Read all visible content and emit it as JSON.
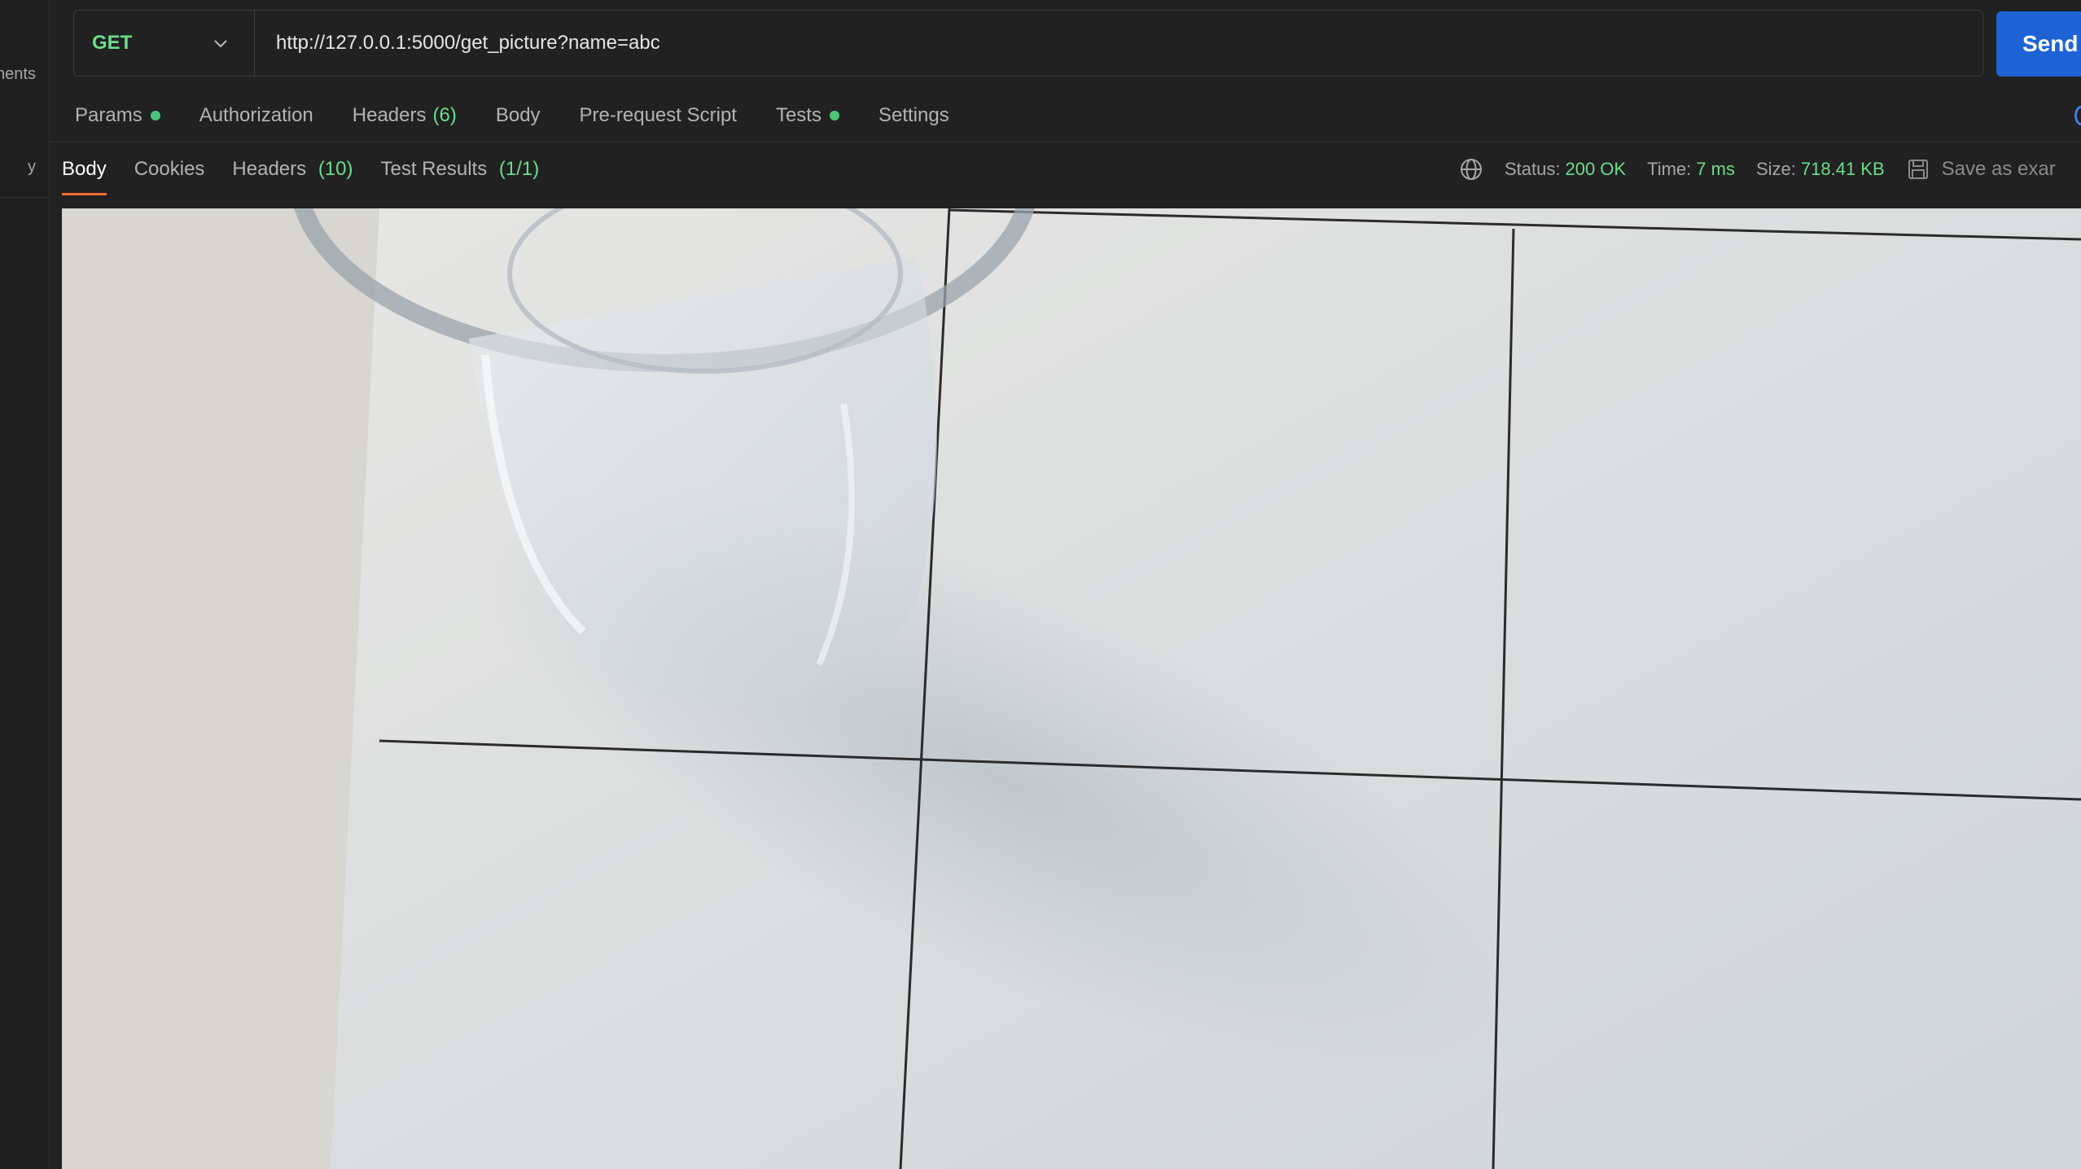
{
  "sidebar": {
    "items": [
      {
        "label": "nents"
      },
      {
        "label": "y"
      }
    ]
  },
  "request": {
    "method": "GET",
    "url": "http://127.0.0.1:5000/get_picture?name=abc",
    "send_label": "Send"
  },
  "request_tabs": {
    "params": "Params",
    "authorization": "Authorization",
    "headers": "Headers",
    "headers_count": "(6)",
    "body": "Body",
    "prerequest": "Pre-request Script",
    "tests": "Tests",
    "settings": "Settings"
  },
  "response_tabs": {
    "body": "Body",
    "cookies": "Cookies",
    "headers": "Headers",
    "headers_count": "(10)",
    "test_results": "Test Results",
    "test_results_count": "(1/1)"
  },
  "status": {
    "status_label": "Status:",
    "status_value": "200 OK",
    "time_label": "Time:",
    "time_value": "7 ms",
    "size_label": "Size:",
    "size_value": "718.41 KB",
    "save_example": "Save as exar"
  },
  "colors": {
    "method_green": "#6bdd8b",
    "send_blue": "#1e63d6",
    "active_tab_orange": "#ff6c37",
    "dot_green": "#4cc57a"
  },
  "icons": {
    "method_dropdown": "chevron-down-icon",
    "globe": "globe-icon",
    "save": "save-icon"
  },
  "response_body": {
    "content_type": "image"
  }
}
